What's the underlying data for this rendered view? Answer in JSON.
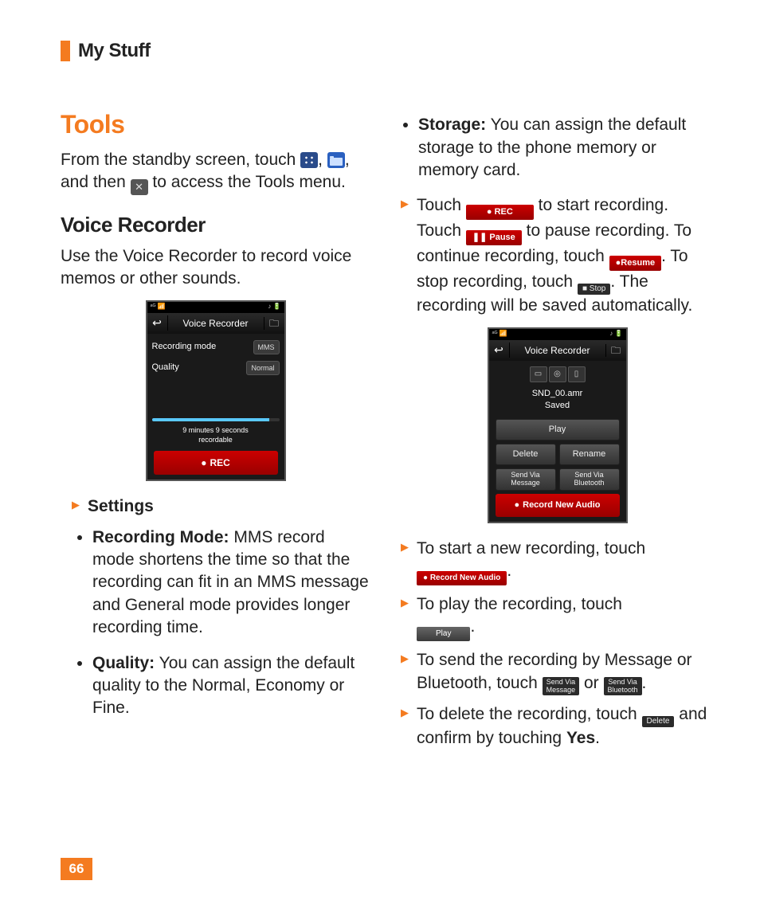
{
  "header": {
    "title": "My Stuff"
  },
  "h1": "Tools",
  "intro": {
    "pre": "From the standby screen, touch ",
    "between": ", ",
    "after_folder": ", and then ",
    "after_wrench": " to access the Tools menu."
  },
  "h2_voice": "Voice Recorder",
  "voice_desc": "Use the Voice Recorder to record voice memos or other sounds.",
  "phone1": {
    "status_left": "ᵃᴳ 📶",
    "status_right": "♪ 🔋",
    "title": "Voice Recorder",
    "row1_label": "Recording mode",
    "row1_val": "MMS",
    "row2_label": "Quality",
    "row2_val": "Normal",
    "rectext_line1": "9 minutes 9 seconds",
    "rectext_line2": "recordable",
    "rec": "REC"
  },
  "settings_head": "Settings",
  "bullets_left": [
    {
      "bold": "Recording Mode:",
      "text": " MMS record mode shortens the time so that the recording can fit in an MMS message and General mode provides longer recording time."
    },
    {
      "bold": "Quality:",
      "text": " You can assign the default quality to the Normal, Economy or Fine."
    }
  ],
  "right_bullet": {
    "bold": "Storage:",
    "text": " You can assign the default storage to the phone memory or memory card."
  },
  "rec_para": {
    "p1a": "Touch ",
    "btn_rec": "● REC",
    "p1b": " to start recording. Touch ",
    "btn_pause": "❚❚ Pause",
    "p1c": " to pause recording. To continue recording, touch ",
    "btn_resume": "●Resume",
    "p1d": ". To stop recording, touch ",
    "btn_stop": "■ Stop",
    "p1e": ". The recording will be saved automatically."
  },
  "phone2": {
    "title": "Voice Recorder",
    "file_line1": "SND_00.amr",
    "file_line2": "Saved",
    "play": "Play",
    "delete": "Delete",
    "rename": "Rename",
    "send_msg_l1": "Send Via",
    "send_msg_l2": "Message",
    "send_bt_l1": "Send Via",
    "send_bt_l2": "Bluetooth",
    "recnew": "Record New Audio"
  },
  "steps": {
    "s1": "To start a new recording, touch",
    "s1_btn": "● Record New Audio",
    "s2": "To play the recording, touch",
    "s2_btn": "Play",
    "s3a": "To send the recording by Message or Bluetooth, touch ",
    "s3_or": " or ",
    "s3_btn1_l1": "Send Via",
    "s3_btn1_l2": "Message",
    "s3_btn2_l1": "Send Via",
    "s3_btn2_l2": "Bluetooth",
    "s4a": "To delete the recording, touch ",
    "s4_btn": "Delete",
    "s4b": " and confirm by touching ",
    "s4_yes": "Yes",
    "s4c": "."
  },
  "pagenum": "66"
}
